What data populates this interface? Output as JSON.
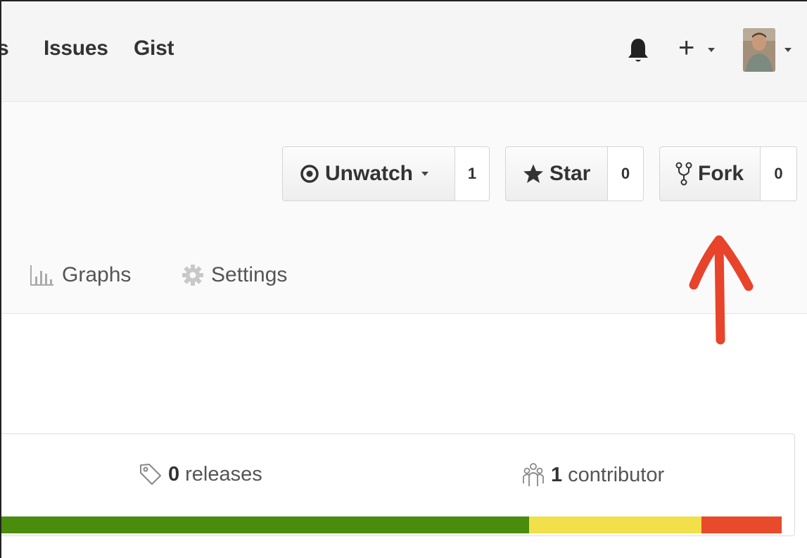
{
  "header": {
    "nav": [
      {
        "label": "s"
      },
      {
        "label": "Issues"
      },
      {
        "label": "Gist"
      }
    ],
    "icons": {
      "bell": "bell-icon",
      "plus": "plus-icon",
      "avatar": "user-avatar"
    },
    "plus_label": "+"
  },
  "repo": {
    "watch": {
      "label": "Unwatch",
      "count": "1",
      "icon": "eye-icon"
    },
    "star": {
      "label": "Star",
      "count": "0",
      "icon": "star-icon"
    },
    "fork": {
      "label": "Fork",
      "count": "0",
      "icon": "fork-icon"
    },
    "tabs": [
      {
        "label": "Graphs",
        "icon": "graph-icon"
      },
      {
        "label": "Settings",
        "icon": "gear-icon"
      }
    ]
  },
  "summary": {
    "releases": {
      "count": "0",
      "label": "releases",
      "icon": "tag-icon"
    },
    "contributors": {
      "count": "1",
      "label": "contributor",
      "icon": "people-icon"
    },
    "language_bar": [
      {
        "color": "#4a8c0c",
        "share": 0.665
      },
      {
        "color": "#f1e04a",
        "share": 0.217
      },
      {
        "color": "#e84a2c",
        "share": 0.1
      }
    ]
  },
  "annotation": {
    "arrow_color": "#e8432b"
  }
}
